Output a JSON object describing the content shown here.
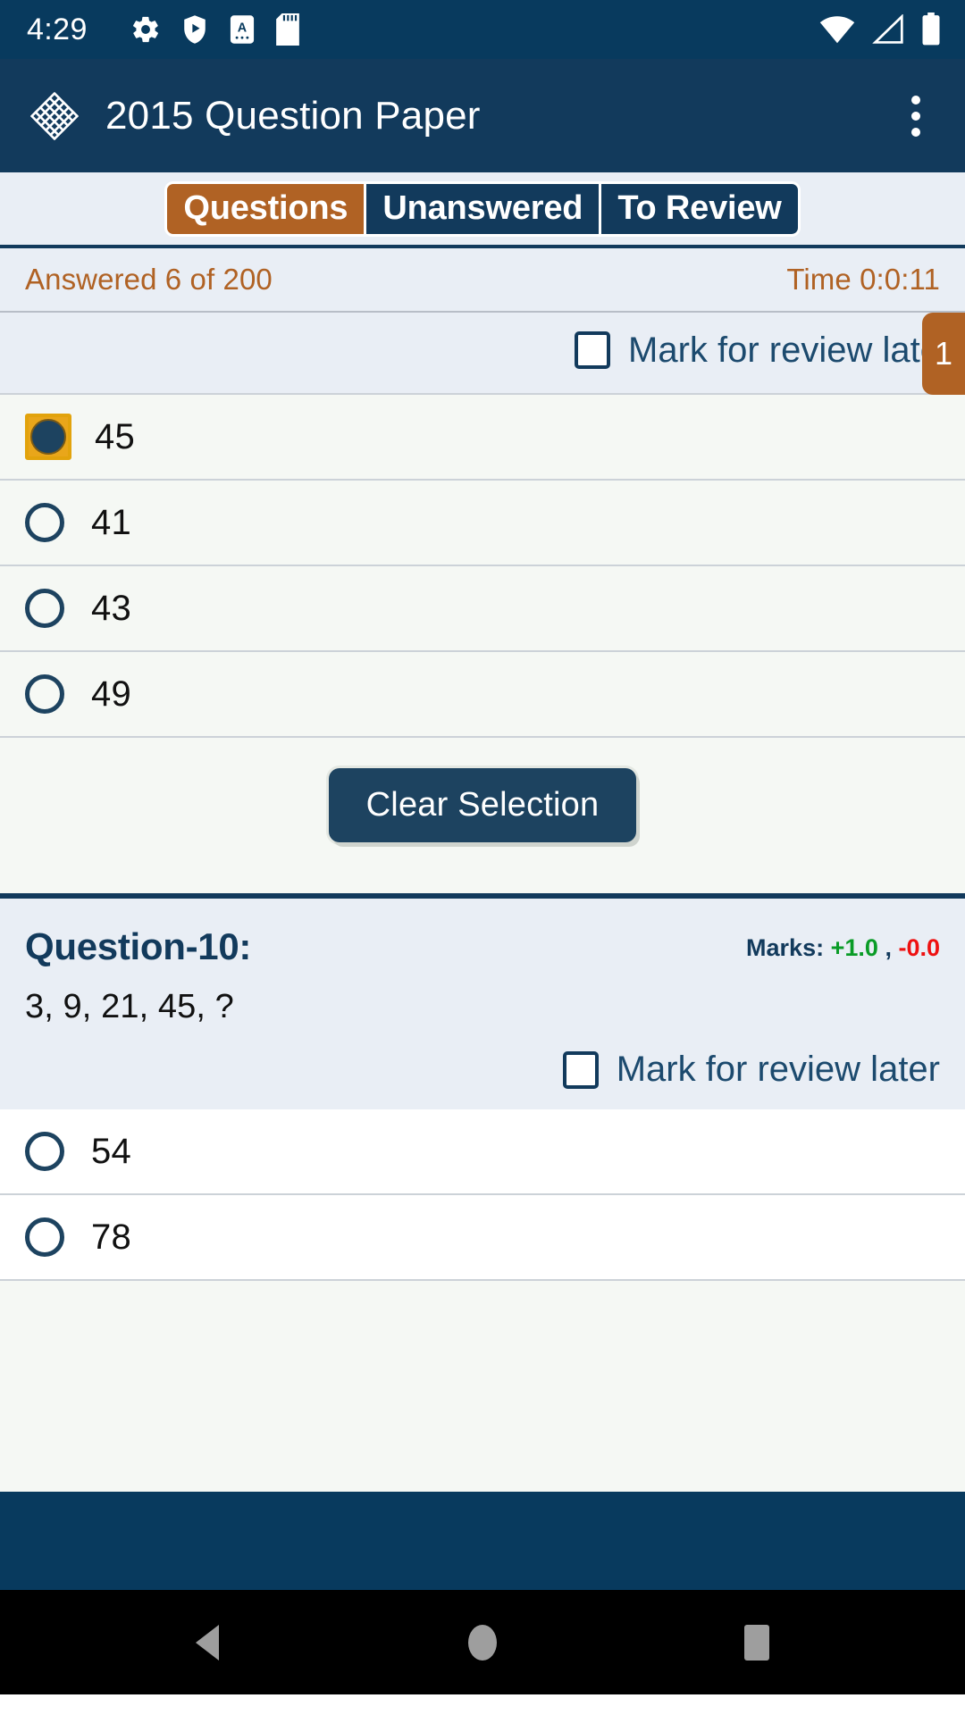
{
  "status_bar": {
    "clock": "4:29",
    "left_icons": [
      "gear-icon",
      "play-protect-shield-icon",
      "app-letter-a-icon",
      "sd-card-icon"
    ],
    "right_icons": [
      "wifi-icon",
      "cell-signal-icon",
      "battery-icon"
    ]
  },
  "app_bar": {
    "logo": "diamond-lattice-logo",
    "title": "2015 Question Paper",
    "overflow": "overflow-menu-icon"
  },
  "tabs": [
    {
      "label": "Questions",
      "active": true
    },
    {
      "label": "Unanswered",
      "active": false
    },
    {
      "label": "To Review",
      "active": false
    }
  ],
  "progress": {
    "answered_text": "Answered 6 of 200",
    "time_text": "Time 0:0:11"
  },
  "questions": [
    {
      "review_label": "Mark for review late",
      "review_checked": false,
      "badge": "1",
      "options": [
        {
          "label": "45",
          "selected": true
        },
        {
          "label": "41",
          "selected": false
        },
        {
          "label": "43",
          "selected": false
        },
        {
          "label": "49",
          "selected": false
        }
      ],
      "clear_button": "Clear Selection"
    },
    {
      "number": "Question-10:",
      "marks_prefix": "Marks:",
      "marks_positive": "+1.0",
      "marks_separator": ",",
      "marks_negative": "-0.0",
      "text": "3, 9, 21, 45, ?",
      "review_label": "Mark for review later",
      "review_checked": false,
      "options": [
        {
          "label": "54",
          "selected": false
        },
        {
          "label": "78",
          "selected": false
        }
      ]
    }
  ],
  "nav_bar": {
    "back": "back-triangle-icon",
    "home": "home-circle-icon",
    "recents": "recents-square-icon"
  },
  "colors": {
    "accent_orange": "#b06224",
    "navy": "#123a5c",
    "status_navy": "#083a5e",
    "card_blue": "#e9eef5",
    "option_bg": "#f5f8f4",
    "marks_positive": "#0a9c27",
    "marks_negative": "#ee1111",
    "selected_ring": "#e9a61a"
  }
}
